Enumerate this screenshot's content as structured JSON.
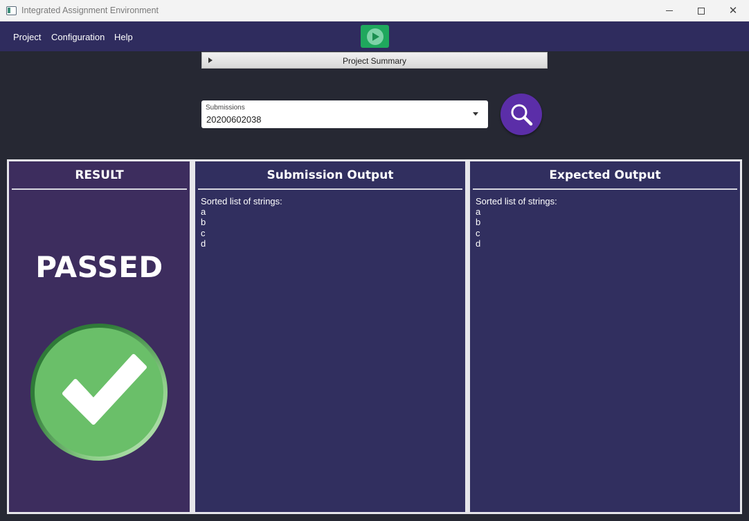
{
  "window": {
    "title": "Integrated Assignment Environment"
  },
  "menu": {
    "items": [
      "Project",
      "Configuration",
      "Help"
    ]
  },
  "toolbar": {
    "run_icon": "play-icon"
  },
  "summary": {
    "label": "Project Summary"
  },
  "submissions": {
    "label": "Submissions",
    "value": "20200602038"
  },
  "panels": {
    "result": {
      "title": "RESULT",
      "status": "PASSED",
      "icon": "checkmark-icon"
    },
    "submission_output": {
      "title": "Submission Output",
      "text": "Sorted list of strings:\na\nb\nc\nd"
    },
    "expected_output": {
      "title": "Expected Output",
      "text": "Sorted list of strings:\na\nb\nc\nd"
    }
  },
  "colors": {
    "menubar": "#2f2c5e",
    "run_button": "#1fa85d",
    "search_button": "#5b2ea8",
    "result_panel": "#3d2d5e",
    "output_panel": "#312f5f",
    "passed_green": "#6abf69"
  }
}
